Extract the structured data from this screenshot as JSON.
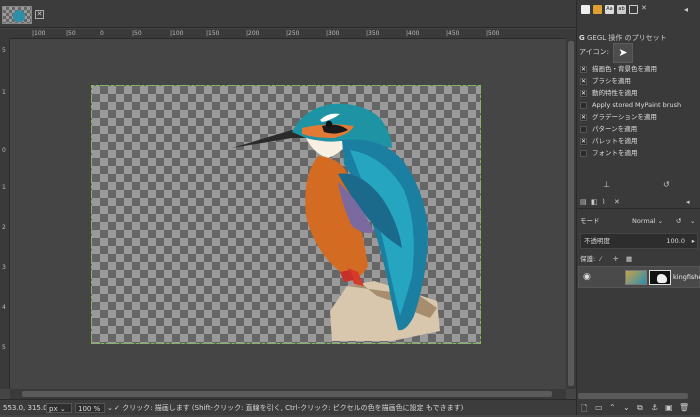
{
  "tabs": {
    "close_icon": "close-icon"
  },
  "rulers": {
    "h_ticks": [
      "|100",
      "|50",
      "0",
      "|50",
      "|100",
      "|150",
      "|200",
      "|250",
      "|300",
      "|350",
      "|400",
      "|450",
      "|500"
    ],
    "v_ticks": [
      "5",
      "1",
      "0",
      "1",
      "2",
      "3",
      "4",
      "5"
    ]
  },
  "status": {
    "coords": "553.0, 315.0",
    "unit": "px",
    "zoom": "100 %",
    "message": "クリック: 描画します (Shift-クリック: 直線を引く, Ctrl-クリック: ピクセルの色を描画色に設定 もできます)"
  },
  "tool_presets": {
    "title": "GEGL 操作 のプリセット",
    "icon_label": "アイコン:",
    "options": [
      {
        "label": "描画色・背景色を適用",
        "checked": true
      },
      {
        "label": "ブラシを適用",
        "checked": true
      },
      {
        "label": "動的特性を適用",
        "checked": true
      },
      {
        "label": "Apply stored MyPaint brush",
        "checked": false
      },
      {
        "label": "グラデーションを適用",
        "checked": true
      },
      {
        "label": "パターンを適用",
        "checked": false
      },
      {
        "label": "パレットを適用",
        "checked": true
      },
      {
        "label": "フォントを適用",
        "checked": false
      }
    ]
  },
  "layers": {
    "mode_label": "モード",
    "mode_value": "Normal",
    "opacity_label": "不透明度",
    "opacity_value": "100.0",
    "lock_label": "保護:",
    "layer_name": "kingfishe"
  },
  "colors": {
    "accent": "#7fbf4f",
    "bg": "#454545"
  }
}
